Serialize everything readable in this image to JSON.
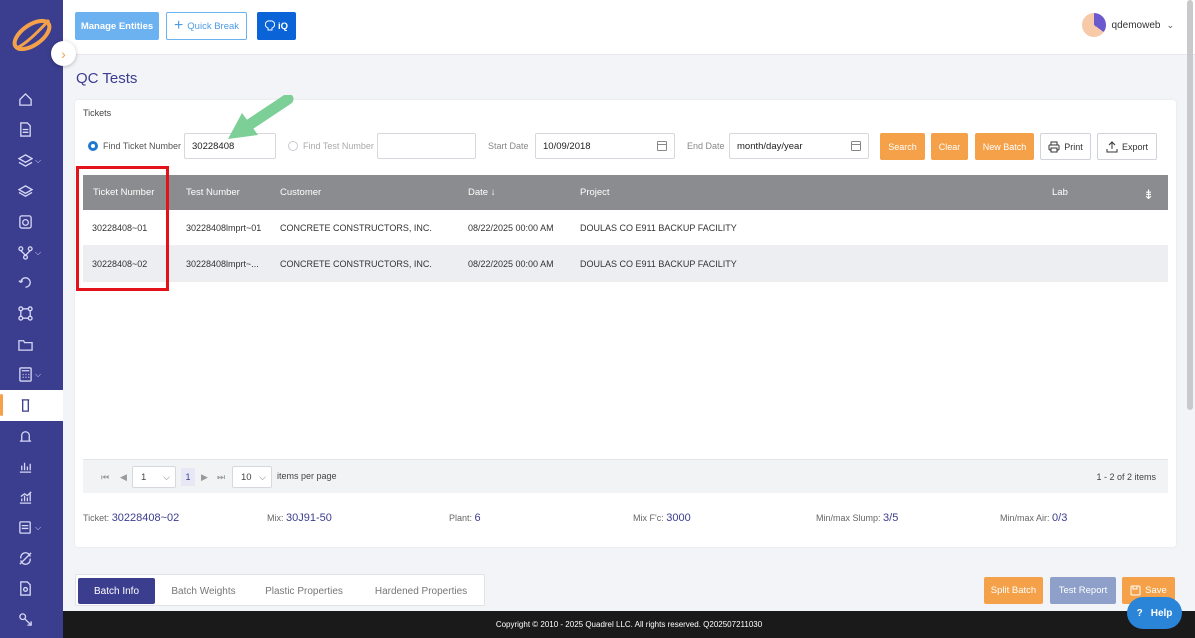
{
  "header": {
    "manage_entities": "Manage Entities",
    "quick_break": "Quick Break",
    "iq": "iQ",
    "username": "qdemoweb"
  },
  "page": {
    "title": "QC Tests"
  },
  "filters": {
    "section_label": "Tickets",
    "find_ticket_label": "Find Ticket Number",
    "find_ticket_value": "30228408",
    "find_test_label": "Find Test Number",
    "find_test_value": "",
    "start_date_label": "Start Date",
    "start_date_value": "10/09/2018",
    "end_date_label": "End Date",
    "end_date_value": "month/day/year",
    "search": "Search",
    "clear": "Clear",
    "new_batch": "New Batch",
    "print": "Print",
    "export": "Export"
  },
  "table": {
    "columns": [
      "Ticket Number",
      "Test Number",
      "Customer",
      "Date ↓",
      "Project",
      "Lab"
    ],
    "rows": [
      [
        "30228408~01",
        "30228408lmprt~01",
        "CONCRETE CONSTRUCTORS, INC.",
        "08/22/2025 00:00 AM",
        "DOULAS CO E911 BACKUP FACILITY",
        ""
      ],
      [
        "30228408~02",
        "30228408lmprt~...",
        "CONCRETE CONSTRUCTORS, INC.",
        "08/22/2025 00:00 AM",
        "DOULAS CO E911 BACKUP FACILITY",
        ""
      ]
    ]
  },
  "pager": {
    "page_value": "1",
    "current_page": "1",
    "page_size": "10",
    "per_page_label": "items per page",
    "info": "1 - 2 of 2 items"
  },
  "summary": {
    "ticket_label": "Ticket:",
    "ticket_value": "30228408~02",
    "mix_label": "Mix:",
    "mix_value": "30J91-50",
    "plant_label": "Plant:",
    "plant_value": "6",
    "mixfc_label": "Mix F'c:",
    "mixfc_value": "3000",
    "slump_label": "Min/max Slump:",
    "slump_value": "3/5",
    "air_label": "Min/max Air:",
    "air_value": "0/3"
  },
  "tabs": [
    "Batch Info",
    "Batch Weights",
    "Plastic Properties",
    "Hardened Properties"
  ],
  "actions": {
    "split": "Split Batch",
    "report": "Test Report",
    "save": "Save"
  },
  "footer": {
    "copyright": "Copyright © 2010 - 2025 Quadrel LLC. All rights reserved. Q202507211030"
  },
  "help": {
    "label": "Help"
  },
  "colors": {
    "brand": "#3b3d8f",
    "accent": "#f4a14a",
    "highlight": "#e3111a"
  }
}
